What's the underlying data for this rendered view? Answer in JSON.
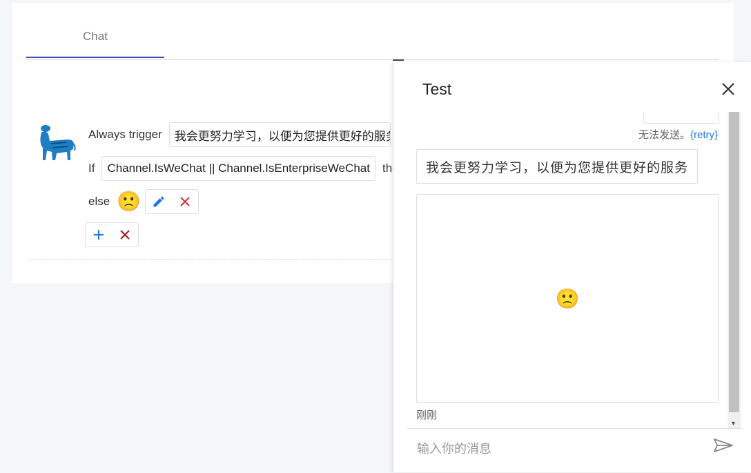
{
  "tabs": [
    {
      "label": "Chat"
    }
  ],
  "rule": {
    "always_trigger_label": "Always trigger",
    "always_trigger_value": "我会更努力学习，以便为您提供更好的服务",
    "if_label": "If",
    "if_condition": "Channel.IsWeChat || Channel.IsEnterpriseWeChat",
    "then_label": "then",
    "else_label": "else",
    "else_emoji": "🙁"
  },
  "drawer": {
    "title": "Test",
    "status_text": "无法发送。",
    "retry_label": "{retry}",
    "messages": [
      {
        "text": "我会更努力学习，以便为您提供更好的服务"
      },
      {
        "emoji": "🙁"
      }
    ],
    "timestamp": "刚刚",
    "input_placeholder": "输入你的消息"
  },
  "colors": {
    "accent": "#3f51b5",
    "edit": "#1a73e8",
    "delete": "#d32f2f"
  }
}
